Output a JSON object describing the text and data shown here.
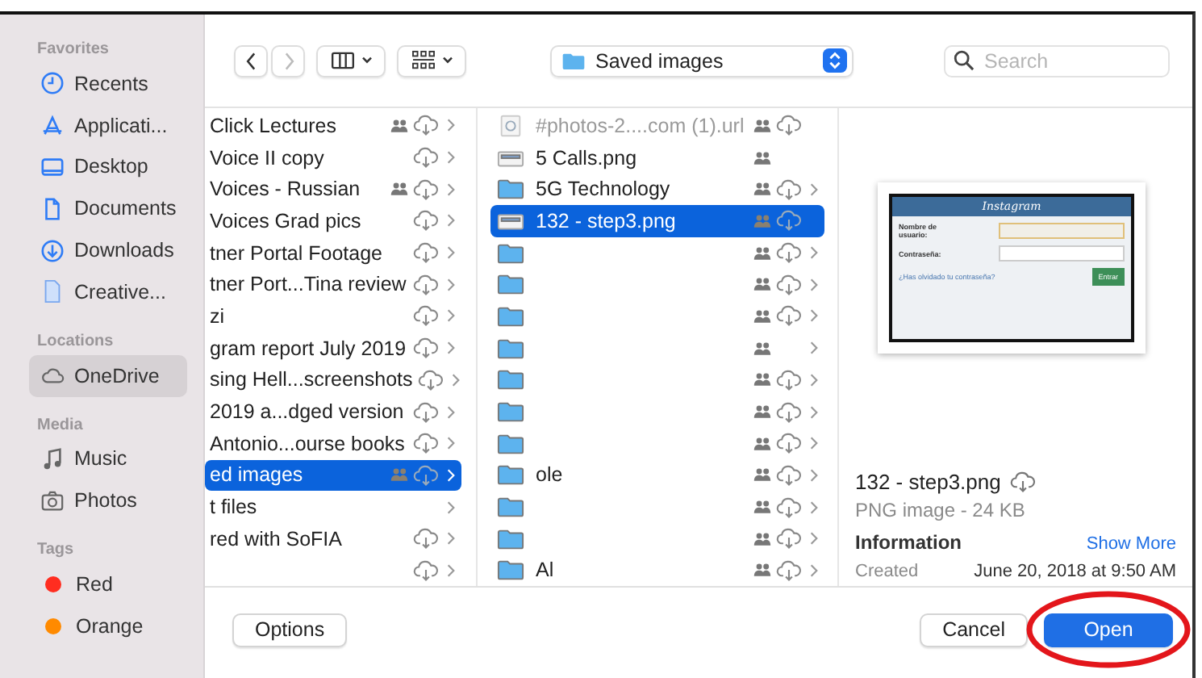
{
  "sidebar": {
    "sections": [
      {
        "heading": "Favorites",
        "items": [
          {
            "label": "Recents",
            "kind": "clock",
            "selected": false
          },
          {
            "label": "Applicati...",
            "kind": "apps",
            "selected": false
          },
          {
            "label": "Desktop",
            "kind": "desktop",
            "selected": false
          },
          {
            "label": "Documents",
            "kind": "doc",
            "selected": false
          },
          {
            "label": "Downloads",
            "kind": "download",
            "selected": false
          },
          {
            "label": "Creative...",
            "kind": "file",
            "selected": false
          }
        ]
      },
      {
        "heading": "Locations",
        "items": [
          {
            "label": "OneDrive",
            "kind": "cloud",
            "selected": true
          }
        ]
      },
      {
        "heading": "Media",
        "items": [
          {
            "label": "Music",
            "kind": "music",
            "selected": false
          },
          {
            "label": "Photos",
            "kind": "camera",
            "selected": false
          }
        ]
      },
      {
        "heading": "Tags",
        "items": [
          {
            "label": "Red",
            "kind": "tag",
            "color": "#ff2d20",
            "selected": false
          },
          {
            "label": "Orange",
            "kind": "tag",
            "color": "#ff8a00",
            "selected": false
          }
        ]
      }
    ]
  },
  "toolbar": {
    "location": "Saved images",
    "search": {
      "placeholder": "Search"
    }
  },
  "columns": [
    {
      "rows": [
        {
          "name": "Click Lectures",
          "shared": true,
          "cloud": true,
          "chevron": true,
          "selected": false
        },
        {
          "name": "Voice II copy",
          "shared": false,
          "cloud": true,
          "chevron": true,
          "selected": false
        },
        {
          "name": "Voices - Russian",
          "shared": true,
          "cloud": true,
          "chevron": true,
          "selected": false
        },
        {
          "name": "Voices Grad pics",
          "shared": false,
          "cloud": true,
          "chevron": true,
          "selected": false
        },
        {
          "name": "tner Portal Footage",
          "shared": false,
          "cloud": true,
          "chevron": true,
          "selected": false
        },
        {
          "name": "tner Port...Tina review",
          "shared": false,
          "cloud": true,
          "chevron": true,
          "selected": false
        },
        {
          "name": "zi",
          "shared": false,
          "cloud": true,
          "chevron": true,
          "selected": false
        },
        {
          "name": "gram report July 2019",
          "shared": false,
          "cloud": true,
          "chevron": true,
          "selected": false
        },
        {
          "name": "sing Hell...screenshots",
          "shared": false,
          "cloud": true,
          "chevron": true,
          "selected": false
        },
        {
          "name": "2019 a...dged version",
          "shared": false,
          "cloud": true,
          "chevron": true,
          "selected": false
        },
        {
          "name": "Antonio...ourse books",
          "shared": false,
          "cloud": true,
          "chevron": true,
          "selected": false
        },
        {
          "name": "ed images",
          "shared": true,
          "cloud": true,
          "chevron": true,
          "selected": true
        },
        {
          "name": "t files",
          "shared": false,
          "cloud": false,
          "chevron": true,
          "selected": false
        },
        {
          "name": "red with SoFIA",
          "shared": false,
          "cloud": true,
          "chevron": true,
          "selected": false
        },
        {
          "shared": false,
          "cloud": true,
          "chevron": true,
          "selected": false
        }
      ]
    },
    {
      "rows": [
        {
          "kind": "link",
          "name": "#photos-2....com (1).url",
          "disabled": true,
          "shared": true,
          "cloud": true,
          "chevron": false,
          "selected": false
        },
        {
          "kind": "image",
          "name": "5 Calls.png",
          "disabled": false,
          "shared": true,
          "cloud": false,
          "chevron": false,
          "selected": false
        },
        {
          "kind": "folder",
          "name": "5G Technology",
          "disabled": false,
          "shared": true,
          "cloud": true,
          "chevron": true,
          "selected": false
        },
        {
          "kind": "image",
          "name": "132 - step3.png",
          "disabled": false,
          "shared": true,
          "cloud": true,
          "chevron": false,
          "selected": true
        },
        {
          "kind": "folder",
          "disabled": false,
          "shared": true,
          "cloud": true,
          "chevron": true,
          "selected": false
        },
        {
          "kind": "folder",
          "disabled": false,
          "shared": true,
          "cloud": true,
          "chevron": true,
          "selected": false
        },
        {
          "kind": "folder",
          "disabled": false,
          "shared": true,
          "cloud": true,
          "chevron": true,
          "selected": false
        },
        {
          "kind": "folder",
          "disabled": false,
          "shared": true,
          "cloud": false,
          "chevron": true,
          "selected": false
        },
        {
          "kind": "folder",
          "disabled": false,
          "shared": true,
          "cloud": true,
          "chevron": true,
          "selected": false
        },
        {
          "kind": "folder",
          "disabled": false,
          "shared": true,
          "cloud": true,
          "chevron": true,
          "selected": false
        },
        {
          "kind": "folder",
          "disabled": false,
          "shared": true,
          "cloud": true,
          "chevron": true,
          "selected": false
        },
        {
          "kind": "folder",
          "name": "ole",
          "disabled": false,
          "shared": true,
          "cloud": true,
          "chevron": true,
          "selected": false
        },
        {
          "kind": "folder",
          "disabled": false,
          "shared": true,
          "cloud": true,
          "chevron": true,
          "selected": false
        },
        {
          "kind": "folder",
          "disabled": false,
          "shared": true,
          "cloud": true,
          "chevron": true,
          "selected": false
        },
        {
          "kind": "folder",
          "name": "Al",
          "disabled": false,
          "shared": true,
          "cloud": true,
          "chevron": true,
          "selected": false
        }
      ]
    }
  ],
  "preview": {
    "screenshot": {
      "title": "Instagram",
      "username_label": "Nombre de usuario:",
      "password_label": "Contraseña:",
      "forgot_link": "¿Has olvidado tu contraseña?",
      "button": "Entrar"
    },
    "file_name": "132 - step3.png",
    "cloud": true,
    "file_type": "PNG image - 24 KB",
    "info_heading": "Information",
    "show_more": "Show More",
    "created_label": "Created",
    "created_value": "June 20, 2018 at 9:50 AM"
  },
  "footer": {
    "options": "Options",
    "cancel": "Cancel",
    "open": "Open",
    "open_circled": true
  }
}
